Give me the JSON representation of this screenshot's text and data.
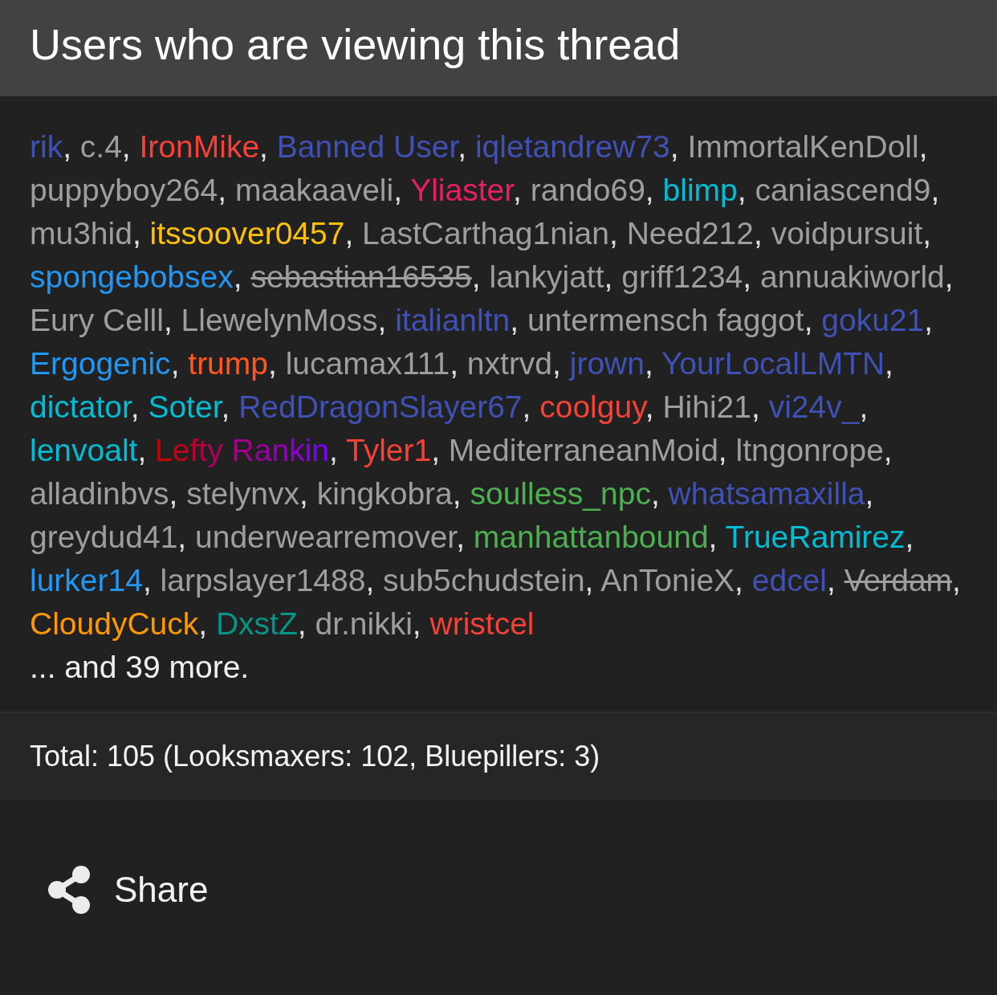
{
  "panel": {
    "title": "Users who are viewing this thread"
  },
  "viewers": {
    "separator": ", ",
    "users": [
      {
        "name": "rik",
        "color": "#3f51b5",
        "strikethrough": false
      },
      {
        "name": "c.4",
        "color": "#9e9e9e",
        "strikethrough": false
      },
      {
        "name": "IronMike",
        "color": "#f44336",
        "strikethrough": false
      },
      {
        "name": "Banned User",
        "color": "#3f51b5",
        "strikethrough": false
      },
      {
        "name": "iqletandrew73",
        "color": "#3f51b5",
        "strikethrough": false
      },
      {
        "name": "ImmortalKenDoll",
        "color": "#9e9e9e",
        "strikethrough": false
      },
      {
        "name": "puppyboy264",
        "color": "#9e9e9e",
        "strikethrough": false
      },
      {
        "name": "maakaaveli",
        "color": "#9e9e9e",
        "strikethrough": false
      },
      {
        "name": "Yliaster",
        "color": "#e91e63",
        "strikethrough": false
      },
      {
        "name": "rando69",
        "color": "#9e9e9e",
        "strikethrough": false
      },
      {
        "name": "blimp",
        "color": "#00bcd4",
        "strikethrough": false
      },
      {
        "name": "caniascend9",
        "color": "#9e9e9e",
        "strikethrough": false
      },
      {
        "name": "mu3hid",
        "color": "#9e9e9e",
        "strikethrough": false
      },
      {
        "name": "itssoover0457",
        "color": "#ffc107",
        "strikethrough": false
      },
      {
        "name": "LastCarthag1nian",
        "color": "#9e9e9e",
        "strikethrough": false
      },
      {
        "name": "Need212",
        "color": "#9e9e9e",
        "strikethrough": false
      },
      {
        "name": "voidpursuit",
        "color": "#9e9e9e",
        "strikethrough": false
      },
      {
        "name": "spongebobsex",
        "color": "#2196f3",
        "strikethrough": false
      },
      {
        "name": "sebastian16535",
        "color": "#9e9e9e",
        "strikethrough": true
      },
      {
        "name": "lankyjatt",
        "color": "#9e9e9e",
        "strikethrough": false
      },
      {
        "name": "griff1234",
        "color": "#9e9e9e",
        "strikethrough": false
      },
      {
        "name": "annuakiworld",
        "color": "#9e9e9e",
        "strikethrough": false
      },
      {
        "name": "Eury Celll",
        "color": "#9e9e9e",
        "strikethrough": false
      },
      {
        "name": "LlewelynMoss",
        "color": "#9e9e9e",
        "strikethrough": false
      },
      {
        "name": "italianltn",
        "color": "#3f51b5",
        "strikethrough": false
      },
      {
        "name": "untermensch faggot",
        "color": "#9e9e9e",
        "strikethrough": false
      },
      {
        "name": "goku21",
        "color": "#3f51b5",
        "strikethrough": false
      },
      {
        "name": "Ergogenic",
        "color": "#2196f3",
        "strikethrough": false
      },
      {
        "name": "trump",
        "color": "#ff5722",
        "strikethrough": false
      },
      {
        "name": "lucamax111",
        "color": "#9e9e9e",
        "strikethrough": false
      },
      {
        "name": "nxtrvd",
        "color": "#9e9e9e",
        "strikethrough": false
      },
      {
        "name": "jrown",
        "color": "#3f51b5",
        "strikethrough": false
      },
      {
        "name": "YourLocalLMTN",
        "color": "#3f51b5",
        "strikethrough": false
      },
      {
        "name": "dictator",
        "color": "#00bcd4",
        "strikethrough": false
      },
      {
        "name": "Soter",
        "color": "#00bcd4",
        "strikethrough": false
      },
      {
        "name": "RedDragonSlayer67",
        "color": "#3f51b5",
        "strikethrough": false
      },
      {
        "name": "coolguy",
        "color": "#f44336",
        "strikethrough": false
      },
      {
        "name": "Hihi21",
        "color": "#9e9e9e",
        "strikethrough": false
      },
      {
        "name": "vi24v_",
        "color": "#3f51b5",
        "strikethrough": false
      },
      {
        "name": "lenvoalt",
        "color": "#00bcd4",
        "strikethrough": false
      },
      {
        "name": "Lefty Rankin",
        "color": "#cc0000",
        "gradient_end": {
          "color": "#7f00ff"
        },
        "strikethrough": false
      },
      {
        "name": "Tyler1",
        "color": "#f44336",
        "strikethrough": false
      },
      {
        "name": "MediterraneanMoid",
        "color": "#9e9e9e",
        "strikethrough": false
      },
      {
        "name": "ltngonrope",
        "color": "#9e9e9e",
        "strikethrough": false
      },
      {
        "name": "alladinbvs",
        "color": "#9e9e9e",
        "strikethrough": false
      },
      {
        "name": "stelynvx",
        "color": "#9e9e9e",
        "strikethrough": false
      },
      {
        "name": "kingkobra",
        "color": "#9e9e9e",
        "strikethrough": false
      },
      {
        "name": "soulless_npc",
        "color": "#4caf50",
        "strikethrough": false
      },
      {
        "name": "whatsamaxilla",
        "color": "#3f51b5",
        "strikethrough": false
      },
      {
        "name": "greydud41",
        "color": "#9e9e9e",
        "strikethrough": false
      },
      {
        "name": "underwearremover",
        "color": "#9e9e9e",
        "strikethrough": false
      },
      {
        "name": "manhattanbound",
        "color": "#4caf50",
        "strikethrough": false
      },
      {
        "name": "TrueRamirez",
        "color": "#00bcd4",
        "strikethrough": false
      },
      {
        "name": "lurker14",
        "color": "#2196f3",
        "strikethrough": false
      },
      {
        "name": "larpslayer1488",
        "color": "#9e9e9e",
        "strikethrough": false
      },
      {
        "name": "sub5chudstein",
        "color": "#9e9e9e",
        "strikethrough": false
      },
      {
        "name": "AnTonieX",
        "color": "#9e9e9e",
        "strikethrough": false
      },
      {
        "name": "edcel",
        "color": "#3f51b5",
        "strikethrough": false
      },
      {
        "name": "Verdam",
        "color": "#9e9e9e",
        "strikethrough": true
      },
      {
        "name": "CloudyCuck",
        "color": "#ff9800",
        "strikethrough": false
      },
      {
        "name": "DxstZ",
        "color": "#009688",
        "strikethrough": false
      },
      {
        "name": "dr.nikki",
        "color": "#9e9e9e",
        "strikethrough": false
      },
      {
        "name": "wristcel",
        "color": "#f44336",
        "strikethrough": false
      }
    ],
    "more": "... and 39 more."
  },
  "footer": {
    "total": "Total: 105 (Looksmaxers: 102, Bluepillers: 3)"
  },
  "share": {
    "label": "Share"
  }
}
